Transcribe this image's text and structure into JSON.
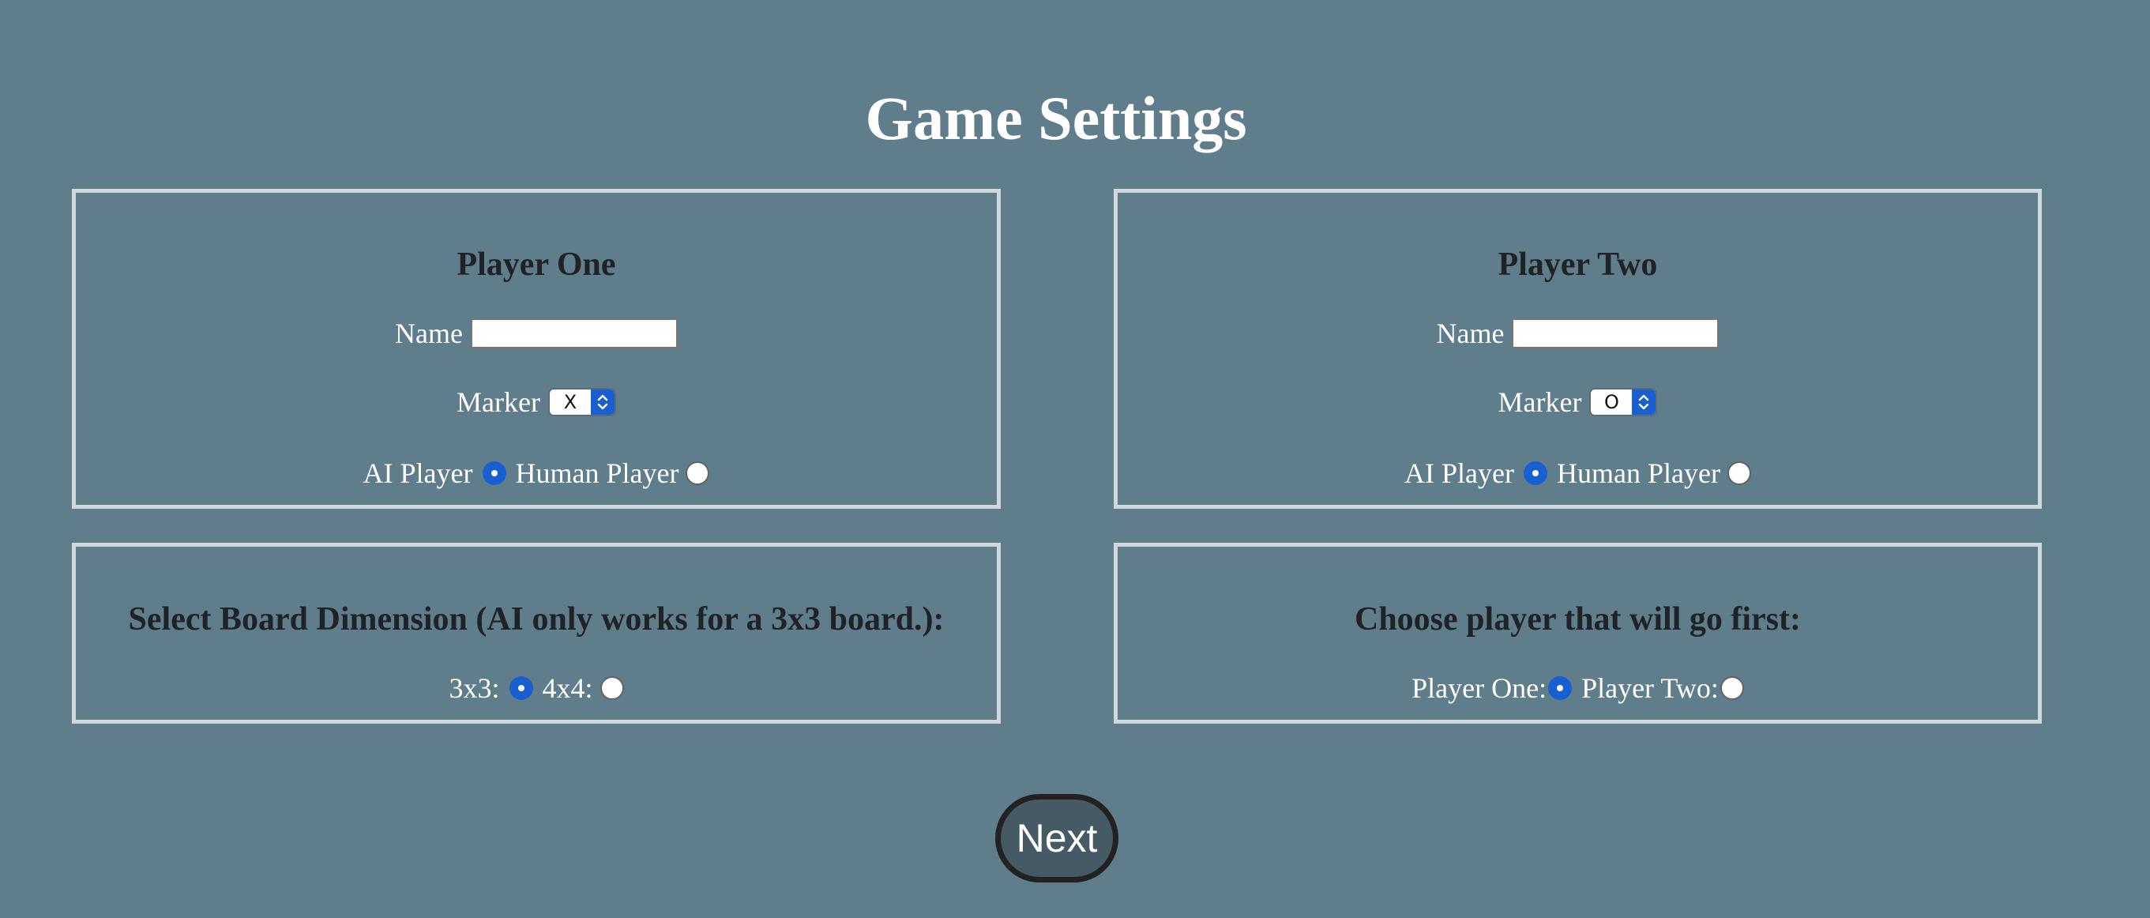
{
  "page": {
    "title": "Game Settings"
  },
  "player_one": {
    "heading": "Player One",
    "name_label": "Name",
    "name_value": "",
    "marker_label": "Marker",
    "marker_value": "X",
    "ai_label": "AI Player",
    "human_label": "Human Player",
    "selected_type": "AI Player"
  },
  "player_two": {
    "heading": "Player Two",
    "name_label": "Name",
    "name_value": "",
    "marker_label": "Marker",
    "marker_value": "O",
    "ai_label": "AI Player",
    "human_label": "Human Player",
    "selected_type": "AI Player"
  },
  "board": {
    "heading": "Select Board Dimension (AI only works for a 3x3 board.):",
    "option_3x3": "3x3:",
    "option_4x4": "4x4:",
    "selected": "3x3:"
  },
  "first_player": {
    "heading": "Choose player that will go first:",
    "option_one": "Player One:",
    "option_two": "Player Two:",
    "selected": "Player One:"
  },
  "next_button": {
    "label": "Next"
  },
  "colors": {
    "background": "#607d8b",
    "panel_border": "#cfd8dc",
    "heading_text": "#1f2328",
    "accent": "#1a5fd0",
    "button_bg": "#455a64"
  }
}
